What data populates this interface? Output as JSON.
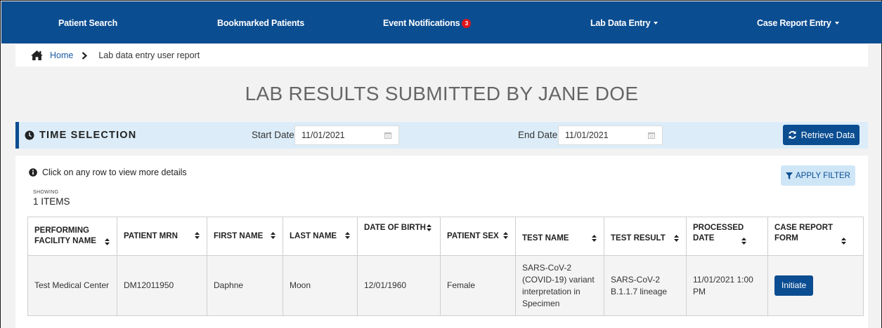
{
  "nav": {
    "items": [
      {
        "label": "Patient Search"
      },
      {
        "label": "Bookmarked Patients"
      },
      {
        "label": "Event Notifications",
        "badge": "3"
      },
      {
        "label": "Lab Data Entry"
      },
      {
        "label": "Case Report Entry"
      }
    ]
  },
  "breadcrumb": {
    "home": "Home",
    "current": "Lab data entry user report"
  },
  "page_title": "LAB RESULTS SUBMITTED BY JANE DOE",
  "time_selection": {
    "title": "TIME SELECTION",
    "start_label": "Start Date",
    "start_value": "11/01/2021",
    "end_label": "End Date",
    "end_value": "11/01/2021",
    "retrieve_label": "Retrieve Data"
  },
  "results": {
    "hint": "Click on any row to view more details",
    "filter_label": "APPLY FILTER",
    "showing_label": "SHOWING",
    "showing_count": "1 ITEMS",
    "columns": [
      "PERFORMING FACILITY NAME",
      "PATIENT MRN",
      "FIRST NAME",
      "LAST NAME",
      "DATE OF BIRTH",
      "PATIENT SEX",
      "TEST NAME",
      "TEST RESULT",
      "PROCESSED DATE",
      "CASE REPORT FORM"
    ],
    "rows": [
      {
        "facility": "Test Medical Center",
        "mrn": "DM12011950",
        "first_name": "Daphne",
        "last_name": "Moon",
        "dob": "12/01/1960",
        "sex": "Female",
        "test_name": "SARS-CoV-2 (COVID-19) variant interpretation in Specimen",
        "test_result": "SARS-CoV-2 B.1.1.7 lineage",
        "processed_date": "11/01/2021 1:00 PM",
        "case_report_action": "Initiate"
      }
    ]
  },
  "colors": {
    "brand": "#0b4d91",
    "badge": "#e0151b",
    "timebar_bg": "#dcedf9",
    "filter_bg": "#cfe6f7"
  },
  "icons": [
    "home-icon",
    "chevron-right-icon",
    "clock-icon",
    "calendar-icon",
    "refresh-icon",
    "info-icon",
    "filter-icon",
    "sort-icon"
  ]
}
